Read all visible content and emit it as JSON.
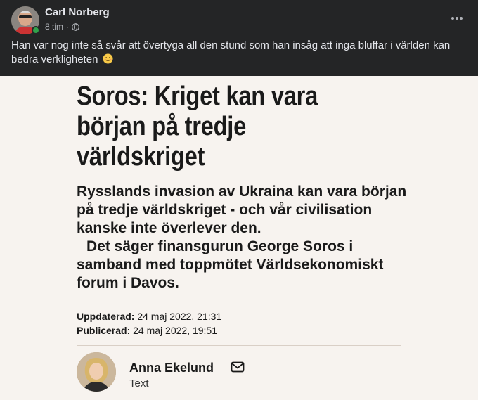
{
  "post": {
    "author": "Carl Norberg",
    "time": "8 tim",
    "dot": "·",
    "more_icon": "more-horizontal-icon",
    "text": "Han var nog inte så svår att övertyga all den stund som han insåg att inga bluffar i världen kan bedra verkligheten",
    "emoji": "smiling-face-icon"
  },
  "article": {
    "headline": "Soros: Kriget kan vara början på tredje världskriget",
    "lead_p1": "Rysslands invasion av Ukraina kan vara början på tredje världskriget - och vår civilisation kanske inte överlever den.",
    "lead_p2": "Det säger finansgurun George Soros i samband med toppmötet Världsekonomiskt forum i Davos.",
    "updated_label": "Uppdaterad:",
    "updated_value": "24 maj 2022, 21:31",
    "published_label": "Publicerad:",
    "published_value": "24 maj 2022, 19:51",
    "byline_name": "Anna Ekelund",
    "byline_role": "Text"
  },
  "colors": {
    "fb_bg": "#242526",
    "fb_text": "#e4e6eb",
    "fb_secondary": "#b0b3b8",
    "online": "#31a24c",
    "article_bg": "#f7f3ef",
    "article_text": "#1a1a1a"
  }
}
